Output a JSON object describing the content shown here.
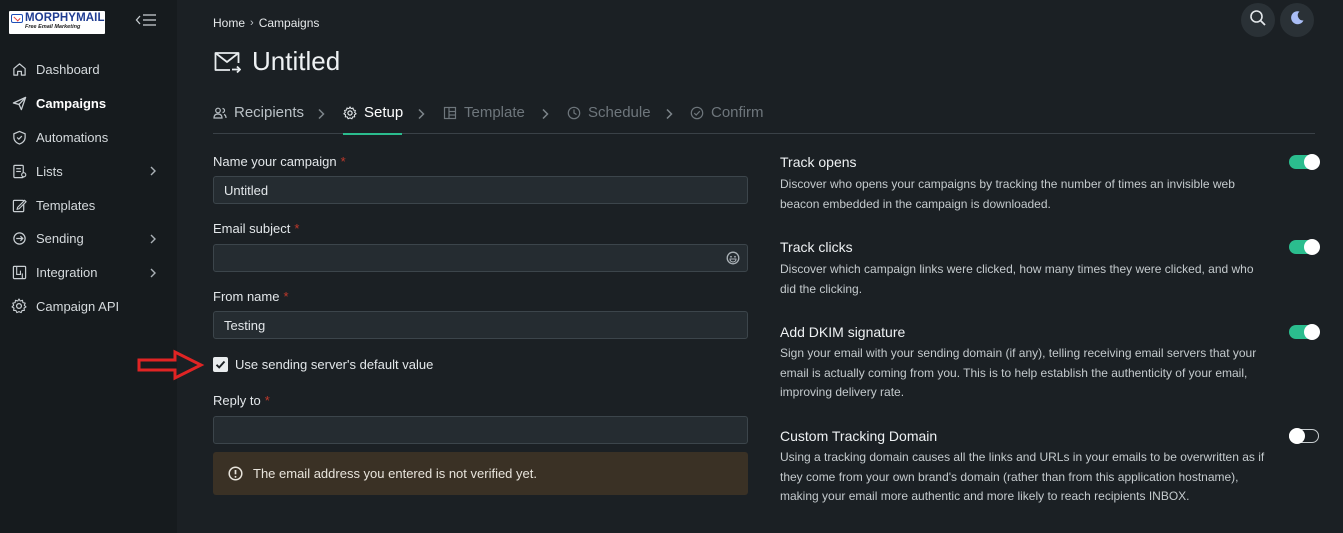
{
  "logo": {
    "brand": "MORPHYMAIL",
    "tagline": "Free Email Marketing"
  },
  "sidebar": {
    "items": [
      {
        "label": "Dashboard",
        "icon": "home-icon",
        "active": false,
        "has_children": false
      },
      {
        "label": "Campaigns",
        "icon": "send-icon",
        "active": true,
        "has_children": false
      },
      {
        "label": "Automations",
        "icon": "shield-icon",
        "active": false,
        "has_children": false
      },
      {
        "label": "Lists",
        "icon": "list-icon",
        "active": false,
        "has_children": true
      },
      {
        "label": "Templates",
        "icon": "edit-icon",
        "active": false,
        "has_children": false
      },
      {
        "label": "Sending",
        "icon": "sending-icon",
        "active": false,
        "has_children": true
      },
      {
        "label": "Integration",
        "icon": "integration-icon",
        "active": false,
        "has_children": true
      },
      {
        "label": "Campaign API",
        "icon": "gear-icon",
        "active": false,
        "has_children": false
      }
    ]
  },
  "breadcrumb": {
    "home": "Home",
    "separator": "›",
    "current": "Campaigns"
  },
  "page": {
    "title": "Untitled"
  },
  "steps": [
    {
      "label": "Recipients",
      "icon": "users-icon",
      "state": "done"
    },
    {
      "label": "Setup",
      "icon": "gear-icon",
      "state": "active"
    },
    {
      "label": "Template",
      "icon": "template-icon",
      "state": "pending"
    },
    {
      "label": "Schedule",
      "icon": "clock-icon",
      "state": "pending"
    },
    {
      "label": "Confirm",
      "icon": "check-circle-icon",
      "state": "pending"
    }
  ],
  "form": {
    "campaign_name": {
      "label": "Name your campaign",
      "required_mark": "*",
      "value": "Untitled"
    },
    "email_subject": {
      "label": "Email subject",
      "required_mark": "*",
      "value": ""
    },
    "from_name": {
      "label": "From name",
      "required_mark": "*",
      "value": "Testing"
    },
    "use_default": {
      "label": "Use sending server's default value",
      "checked": true
    },
    "reply_to": {
      "label": "Reply to",
      "required_mark": "*",
      "value": ""
    },
    "alert": "The email address you entered is not verified yet."
  },
  "options": [
    {
      "title": "Track opens",
      "desc": "Discover who opens your campaigns by tracking the number of times an invisible web beacon embedded in the campaign is downloaded.",
      "enabled": true
    },
    {
      "title": "Track clicks",
      "desc": "Discover which campaign links were clicked, how many times they were clicked, and who did the clicking.",
      "enabled": true
    },
    {
      "title": "Add DKIM signature",
      "desc": "Sign your email with your sending domain (if any), telling receiving email servers that your email is actually coming from you. This is to help establish the authenticity of your email, improving delivery rate.",
      "enabled": true
    },
    {
      "title": "Custom Tracking Domain",
      "desc": "Using a tracking domain causes all the links and URLs in your emails to be overwritten as if they come from your own brand's domain (rather than from this application hostname), making your email more authentic and more likely to reach recipients INBOX.",
      "enabled": false
    }
  ],
  "colors": {
    "accent": "#2bbd8e",
    "background": "#1b2024",
    "sidebar": "#161b1e",
    "alert_bg": "#3a3125",
    "annotation_arrow": "#e02424"
  }
}
